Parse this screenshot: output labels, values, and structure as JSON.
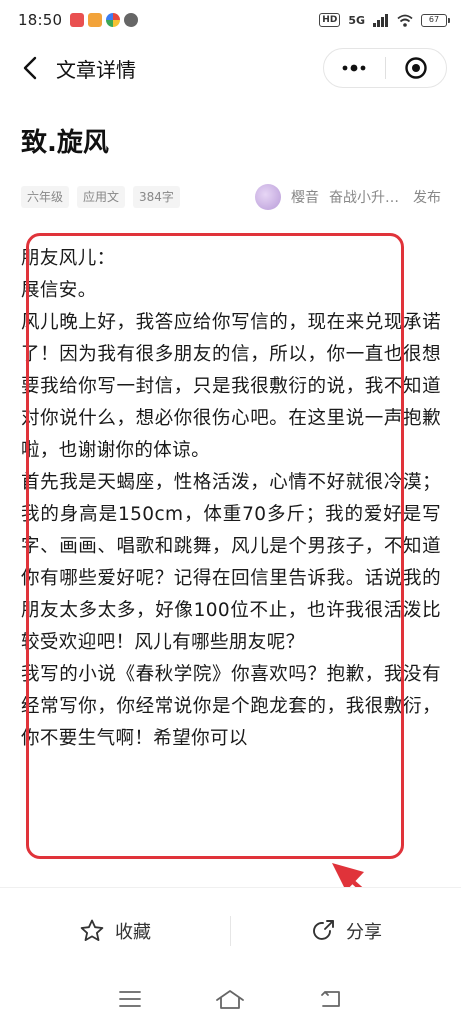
{
  "status_bar": {
    "time": "18:50",
    "network": "5G",
    "battery": "67"
  },
  "nav": {
    "title": "文章详情"
  },
  "article": {
    "title": "致.旋风",
    "tags": [
      "六年级",
      "应用文",
      "384字"
    ],
    "author_name": "樱音",
    "author_desc": "奋战小升…",
    "publish_label": "发布",
    "paragraphs": [
      "朋友风儿：",
      "展信安。",
      "风儿晚上好，我答应给你写信的，现在来兑现承诺了！因为我有很多朋友的信，所以，你一直也很想要我给你写一封信，只是我很敷衍的说，我不知道对你说什么，想必你很伤心吧。在这里说一声抱歉啦，也谢谢你的体谅。",
      "首先我是天蝎座，性格活泼，心情不好就很冷漠；我的身高是150cm，体重70多斤；我的爱好是写字、画画、唱歌和跳舞，风儿是个男孩子，不知道你有哪些爱好呢？记得在回信里告诉我。话说我的朋友太多太多，好像100位不止，也许我很活泼比较受欢迎吧！风儿有哪些朋友呢？",
      "我写的小说《春秋学院》你喜欢吗？抱歉，我没有经常写你，你经常说你是个跑龙套的，我很敷衍，你不要生气啊！希望你可以"
    ]
  },
  "actions": {
    "favorite_label": "收藏",
    "share_label": "分享"
  },
  "colors": {
    "annotation": "#e0333a",
    "text": "#1a1a1a",
    "muted": "#888888"
  }
}
